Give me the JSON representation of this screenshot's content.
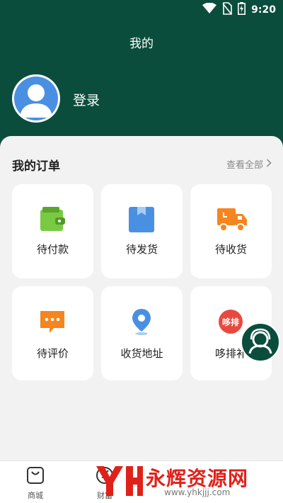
{
  "status_bar": {
    "time": "9:20",
    "icons": [
      "wifi-icon",
      "no-sim-icon",
      "battery-charging-icon"
    ]
  },
  "header": {
    "title": "我的"
  },
  "profile": {
    "login_label": "登录"
  },
  "orders": {
    "title": "我的订单",
    "view_all": "查看全部",
    "items": [
      {
        "label": "待付款",
        "icon": "wallet-icon",
        "color": "#7ac943"
      },
      {
        "label": "待发货",
        "icon": "package-icon",
        "color": "#4a90e2"
      },
      {
        "label": "待收货",
        "icon": "truck-icon",
        "color": "#f5851f"
      },
      {
        "label": "待评价",
        "icon": "chat-bubble-icon",
        "color": "#f5851f"
      },
      {
        "label": "收货地址",
        "icon": "location-pin-icon",
        "color": "#4a90e2"
      },
      {
        "label": "哆排补",
        "icon": "duopai-logo-icon",
        "color": "#e8493f",
        "icon_text": "哆排"
      }
    ]
  },
  "tabbar": {
    "items": [
      {
        "label": "商城",
        "icon": "shopping-bag-icon"
      },
      {
        "label": "财富",
        "icon": "yuan-icon"
      }
    ]
  },
  "watermark": {
    "text": "永辉资源网",
    "url": "www.yhkjjj.com"
  },
  "colors": {
    "header_bg": "#0b4d3c",
    "page_bg": "#f2f2f2",
    "watermark_red": "#e0211a"
  }
}
